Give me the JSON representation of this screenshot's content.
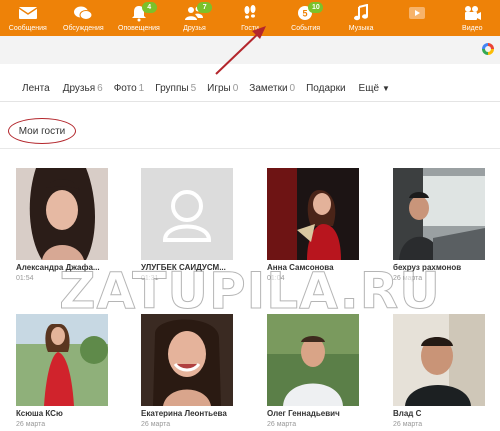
{
  "topnav": {
    "items": [
      {
        "label": "Сообщения",
        "icon": "envelope-icon",
        "badge": ""
      },
      {
        "label": "Обсуждения",
        "icon": "chat-bubbles-icon",
        "badge": ""
      },
      {
        "label": "Оповещения",
        "icon": "bell-icon",
        "badge": "4"
      },
      {
        "label": "Друзья",
        "icon": "friends-icon",
        "badge": "7"
      },
      {
        "label": "Гости",
        "icon": "footprints-icon",
        "badge": ""
      },
      {
        "label": "События",
        "icon": "events-icon",
        "badge": "10"
      },
      {
        "label": "Музыка",
        "icon": "music-note-icon",
        "badge": ""
      },
      {
        "label": "",
        "icon": "play-icon",
        "badge": ""
      },
      {
        "label": "Видео",
        "icon": "video-camera-icon",
        "badge": ""
      }
    ]
  },
  "tabs": [
    {
      "label": "Лента",
      "count": ""
    },
    {
      "label": "Друзья",
      "count": "6"
    },
    {
      "label": "Фото",
      "count": "1"
    },
    {
      "label": "Группы",
      "count": "5"
    },
    {
      "label": "Игры",
      "count": "0"
    },
    {
      "label": "Заметки",
      "count": "0"
    },
    {
      "label": "Подарки",
      "count": ""
    }
  ],
  "tab_more": "Ещё",
  "section_title": "Мои гости",
  "guests": [
    {
      "name": "Александра Джафа...",
      "time": "01:54",
      "photo": "woman-dark-hair"
    },
    {
      "name": "УЛУГБЕК САИДУСМ...",
      "time": "01:31",
      "photo": "placeholder-avatar"
    },
    {
      "name": "Анна Самсонова",
      "time": "01:04",
      "photo": "woman-red-dress"
    },
    {
      "name": "бехруз рахмонов",
      "time": "26 марта",
      "photo": "man-in-car"
    },
    {
      "name": "Ксюша КСю",
      "time": "26 марта",
      "photo": "woman-red-dress-outdoor"
    },
    {
      "name": "Екатерина Леонтьева",
      "time": "26 марта",
      "photo": "woman-smiling"
    },
    {
      "name": "Олег Геннадьевич",
      "time": "26 марта",
      "photo": "man-white-shirt"
    },
    {
      "name": "Влад С",
      "time": "26 марта",
      "photo": "man-smiling"
    }
  ],
  "watermark": "ZATUPILA.RU",
  "colors": {
    "nav_bg": "#ee8208",
    "badge": "#7cc12a",
    "highlight": "#b3262c"
  }
}
